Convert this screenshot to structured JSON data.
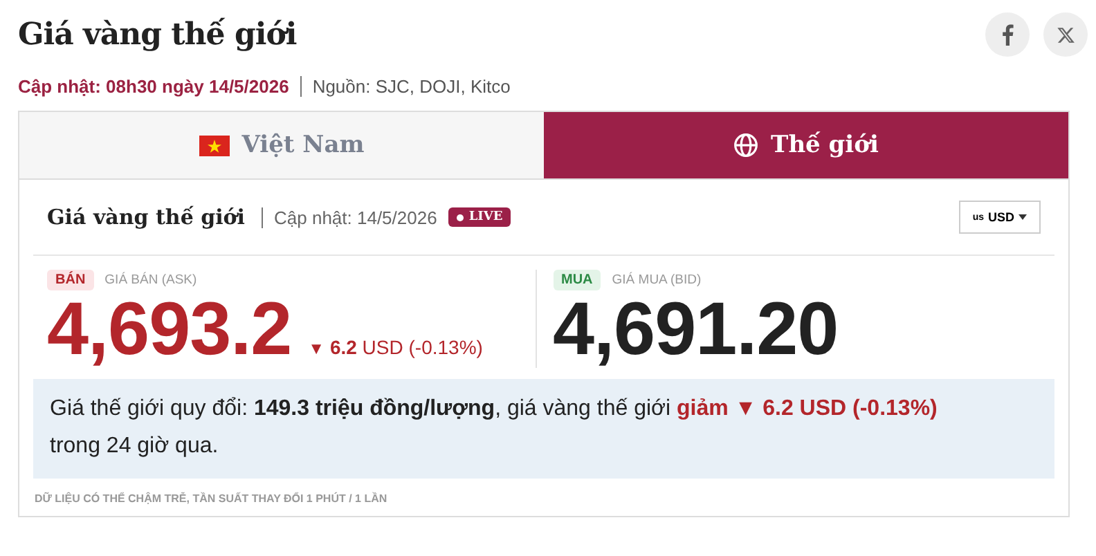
{
  "title": "Giá vàng thế giới",
  "update": {
    "label": "Cập nhật: 08h30 ngày 14/5/2026",
    "source": "Nguồn: SJC, DOJI, Kitco"
  },
  "tabs": [
    {
      "label": "Việt Nam",
      "selected": false
    },
    {
      "label": "Thế giới",
      "selected": true
    }
  ],
  "panel": {
    "title": "Giá vàng thế giới",
    "update": "Cập nhật: 14/5/2026",
    "live": "LIVE",
    "currency": {
      "flag": "us",
      "code": "USD"
    }
  },
  "prices": [
    {
      "kind": "ask",
      "badge": "BÁN",
      "label": "GIÁ BÁN (ASK)",
      "value": "4,693.2",
      "arrow": "▼",
      "change": "6.2",
      "unit": "USD (-0.13%)"
    },
    {
      "kind": "bid",
      "badge": "MUA",
      "label": "GIÁ MUA (BID)",
      "value": "4,691.20"
    }
  ],
  "summary": [
    {
      "kind": "plain",
      "text": "Giá thế giới quy đổi: "
    },
    {
      "kind": "strong",
      "text": "149.3 triệu đồng/lượng"
    },
    {
      "kind": "plain",
      "text": ", giá vàng thế giới "
    },
    {
      "kind": "down",
      "text": "giảm ▼ 6.2 USD (-0.13%)"
    },
    {
      "kind": "plain",
      "text": " trong 24 giờ qua."
    }
  ],
  "footnote": "DỮ LIỆU CÓ THỂ CHẬM TRỄ, TẦN SUẤT THAY ĐỔI 1 PHÚT / 1 LẦN"
}
